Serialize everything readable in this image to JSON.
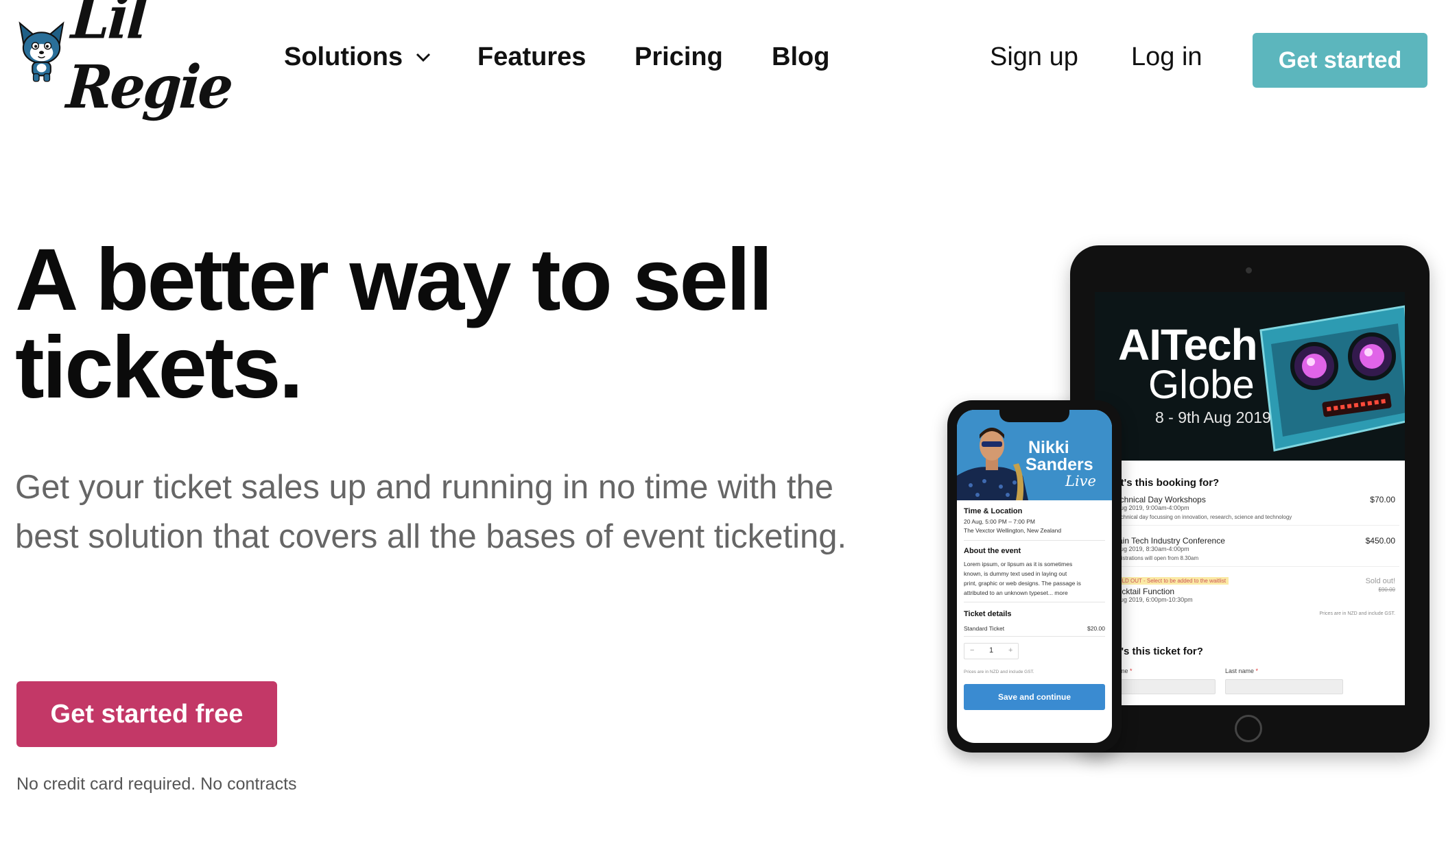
{
  "brand": {
    "logo_text": "Lil Regie"
  },
  "nav": {
    "solutions": "Solutions",
    "features": "Features",
    "pricing": "Pricing",
    "blog": "Blog",
    "sign_up": "Sign up",
    "log_in": "Log in",
    "cta": "Get started"
  },
  "hero": {
    "title": "A better way to sell tickets.",
    "subtitle": "Get your ticket sales up and running in no time with the best solution that covers all the bases of event ticketing.",
    "cta": "Get started free",
    "fineprint": "No credit card required. No contracts"
  },
  "tablet": {
    "event_title_1": "AITech",
    "event_title_2": "Globe",
    "event_dates": "8 - 9th Aug 2019",
    "question_1": "What's this booking for?",
    "tickets": [
      {
        "name": "Technical Day Workshops",
        "meta": "8 Aug 2019, 9:00am-4:00pm",
        "desc": "A technical day focussing on innovation, research, science and technology",
        "price": "$70.00"
      },
      {
        "name": "Main Tech Industry Conference",
        "meta": "9 Aug 2019, 8:30am-4:00pm",
        "desc": "Registrations will open from 8.30am",
        "price": "$450.00"
      },
      {
        "sold_note": "SOLD OUT - Select to be added to the waitlist",
        "name": "Cocktail Function",
        "meta": "9 Aug 2019, 6:00pm-10:30pm",
        "status": "Sold out!",
        "old_price": "$90.00"
      }
    ],
    "prices_note": "Prices are in NZD and include GST.",
    "question_2": "Who's this ticket for?",
    "first_name_label": "First name",
    "last_name_label": "Last name",
    "required_mark": "*"
  },
  "phone": {
    "artist_1": "Nikki",
    "artist_2": "Sanders",
    "artist_3": "Live",
    "time_location_heading": "Time & Location",
    "time_text": "20 Aug, 5:00 PM – 7:00 PM",
    "location_text": "The Vexctor Wellington, New Zealand",
    "about_heading": "About the event",
    "about_lines": [
      "Lorem ipsum, or lipsum as it is sometimes",
      "known, is dummy text used in laying out",
      "print, graphic or web designs. The passage is",
      "attributed to an unknown typeset... more"
    ],
    "ticket_heading": "Ticket details",
    "ticket_name": "Standard Ticket",
    "ticket_price": "$20.00",
    "quantity": "1",
    "minus": "−",
    "plus": "+",
    "prices_note": "Prices are in NZD and include GST.",
    "cta": "Save and continue"
  },
  "colors": {
    "nav_cta": "#5cb6bd",
    "hero_cta": "#c33867",
    "phone_cta": "#3a8bd1"
  }
}
